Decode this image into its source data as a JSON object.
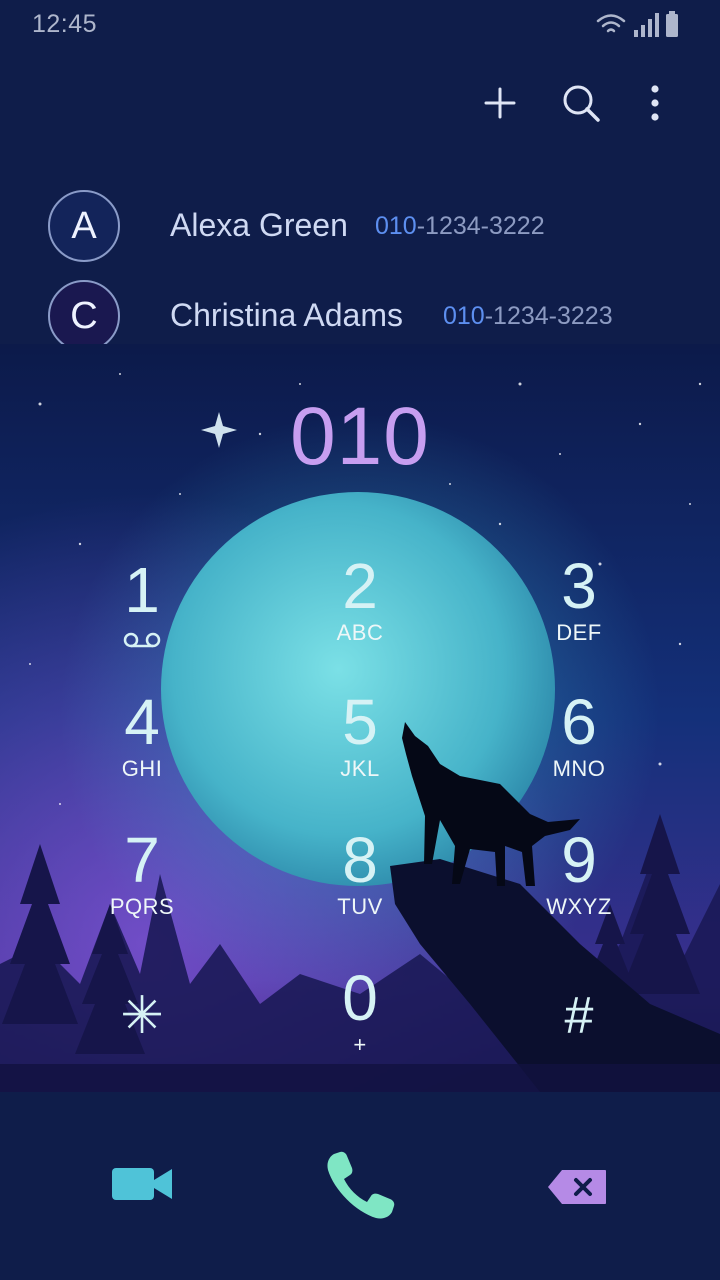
{
  "status_bar": {
    "time": "12:45"
  },
  "toolbar": {
    "icons": [
      "add-icon",
      "search-icon",
      "more-vertical-icon"
    ]
  },
  "contacts": [
    {
      "initial": "A",
      "name": "Alexa Green",
      "number_match": "010",
      "number_rest": "-1234-3222"
    },
    {
      "initial": "C",
      "name": "Christina Adams",
      "number_match": "010",
      "number_rest": "-1234-3223"
    }
  ],
  "dialer": {
    "display": "010",
    "keys": [
      {
        "digit": "1",
        "letters": "",
        "voicemail": true
      },
      {
        "digit": "2",
        "letters": "ABC"
      },
      {
        "digit": "3",
        "letters": "DEF"
      },
      {
        "digit": "4",
        "letters": "GHI"
      },
      {
        "digit": "5",
        "letters": "JKL"
      },
      {
        "digit": "6",
        "letters": "MNO"
      },
      {
        "digit": "7",
        "letters": "PQRS"
      },
      {
        "digit": "8",
        "letters": "TUV"
      },
      {
        "digit": "9",
        "letters": "WXYZ"
      },
      {
        "digit": "✳",
        "letters": ""
      },
      {
        "digit": "0",
        "letters": "+"
      },
      {
        "digit": "#",
        "letters": ""
      }
    ]
  },
  "actions": {
    "icons": [
      "video-call-icon",
      "phone-call-icon",
      "backspace-icon"
    ]
  },
  "colors": {
    "background": "#0f1d4a",
    "display_digits": "#c79ef0",
    "matched_digits": "#5d8ff0",
    "video_icon": "#4fc3d8",
    "call_icon": "#7fe6c4",
    "backspace_icon": "#b58ae6"
  }
}
